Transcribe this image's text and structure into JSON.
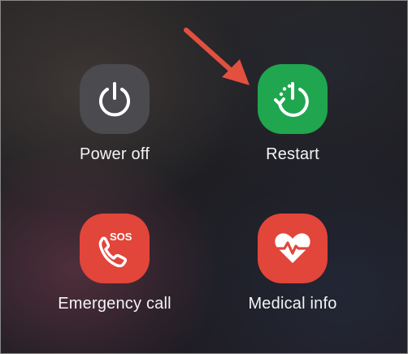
{
  "power_menu": {
    "power_off": {
      "label": "Power off",
      "icon": "power-icon",
      "color": "#4a4a4f"
    },
    "restart": {
      "label": "Restart",
      "icon": "restart-icon",
      "color": "#1fa64f"
    },
    "emergency_call": {
      "label": "Emergency call",
      "icon": "sos-phone-icon",
      "icon_text": "SOS",
      "color": "#e2453a"
    },
    "medical_info": {
      "label": "Medical info",
      "icon": "heart-pulse-icon",
      "color": "#e2453a"
    }
  },
  "annotation": {
    "icon": "red-arrow-icon",
    "color": "#e2503f"
  }
}
